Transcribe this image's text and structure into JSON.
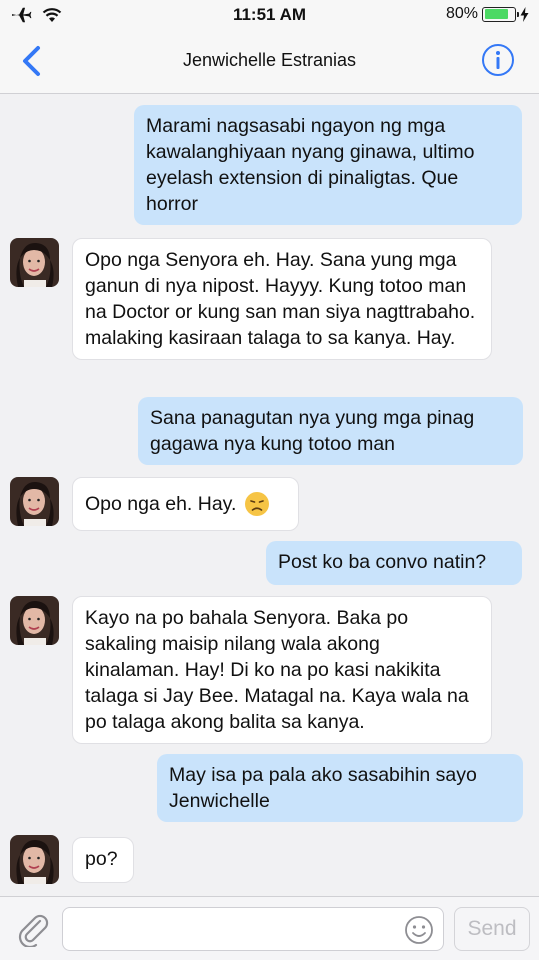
{
  "status": {
    "time": "11:51 AM",
    "battery_text": "80%",
    "battery_level": 0.8
  },
  "header": {
    "contact_name": "Jenwichelle Estranias"
  },
  "messages": [
    {
      "side": "out",
      "text": "Marami nagsasabi ngayon ng mga kawalanghiyaan nyang ginawa, ultimo eyelash extension di pinaligtas. Que horror"
    },
    {
      "side": "in",
      "text": "Opo nga Senyora eh. Hay. Sana yung mga ganun di nya nipost. Hayyy. Kung totoo man na Doctor or kung san man siya nagttrabaho. malaking kasiraan talaga to sa kanya. Hay."
    },
    {
      "side": "out",
      "text": "Sana panagutan nya yung mga pinag gagawa nya kung totoo man"
    },
    {
      "side": "in",
      "text": "Opo nga eh. Hay.",
      "emoji": "disappointed-face"
    },
    {
      "side": "out",
      "text": "Post ko ba convo natin?"
    },
    {
      "side": "in",
      "text": "Kayo na po bahala Senyora. Baka po sakaling maisip nilang wala akong kinalaman. Hay! Di ko na po kasi nakikita talaga si Jay Bee. Matagal na. Kaya wala na po talaga akong balita sa kanya."
    },
    {
      "side": "out",
      "text": "May isa pa pala ako sasabihin sayo Jenwichelle"
    },
    {
      "side": "in",
      "text": "po?"
    }
  ],
  "composer": {
    "placeholder": "",
    "send_label": "Send"
  },
  "colors": {
    "accent": "#3478f6",
    "outgoing_bubble": "#c9e3fb",
    "incoming_bubble": "#ffffff",
    "battery_fill": "#4cd964"
  }
}
